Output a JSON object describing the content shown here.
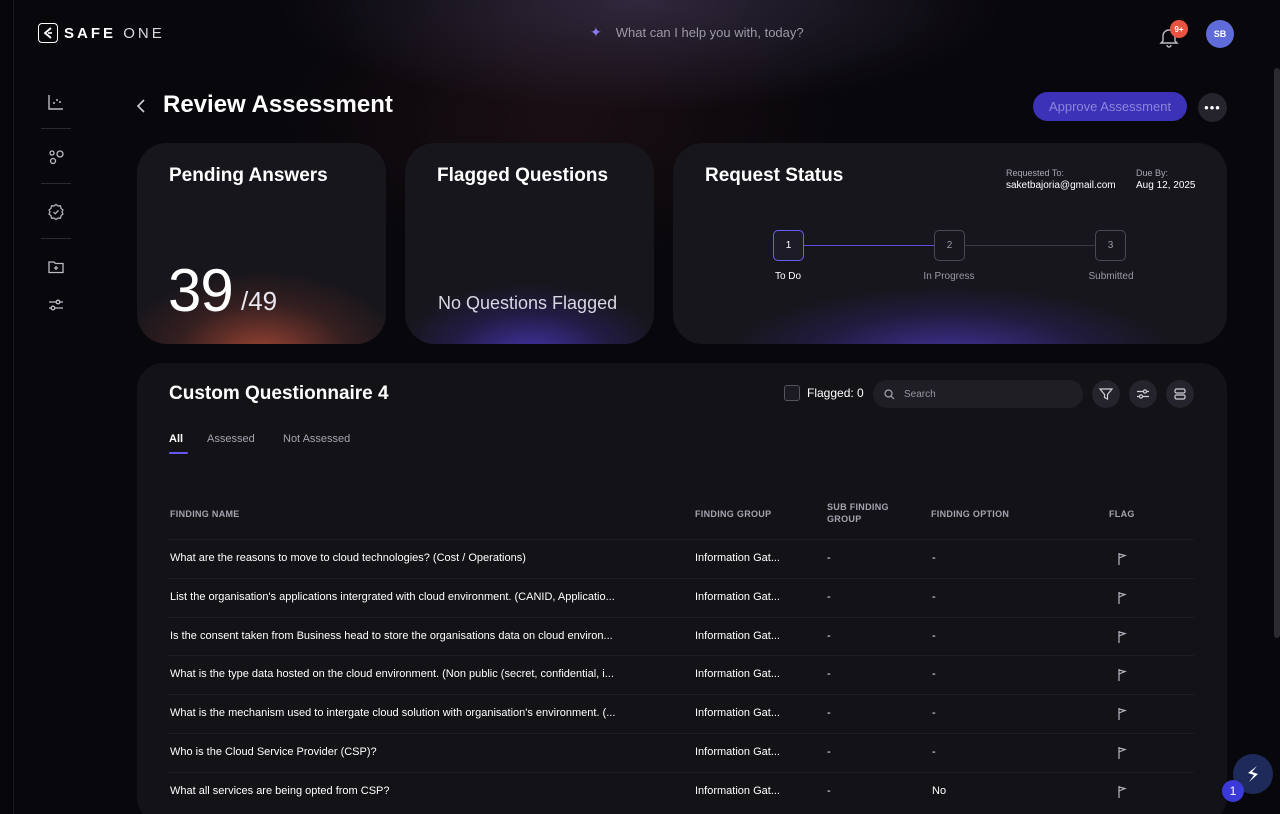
{
  "brand": {
    "bold": "SAFE",
    "light": "ONE"
  },
  "assistant": {
    "prompt": "What can I help you with, today?"
  },
  "notifications": {
    "count": "9+"
  },
  "user": {
    "initials": "SB"
  },
  "sidebar": {
    "items": [
      {
        "icon": "chart-icon"
      },
      {
        "icon": "nodes-icon"
      },
      {
        "icon": "gear-badge-icon"
      },
      {
        "icon": "folder-add-icon"
      },
      {
        "icon": "sliders-icon"
      }
    ]
  },
  "header": {
    "title": "Review Assessment",
    "approve_label": "Approve Assessment",
    "more_label": "•••"
  },
  "pending": {
    "title": "Pending Answers",
    "answered": "39",
    "total": "/49"
  },
  "flagged": {
    "title": "Flagged Questions",
    "empty_text": "No Questions Flagged"
  },
  "status": {
    "title": "Request Status",
    "requested_to_label": "Requested To:",
    "requested_to": "saketbajoria@gmail.com",
    "due_label": "Due By:",
    "due": "Aug 12, 2025",
    "steps": [
      {
        "num": "1",
        "label": "To Do",
        "active": true
      },
      {
        "num": "2",
        "label": "In Progress",
        "active": false
      },
      {
        "num": "3",
        "label": "Submitted",
        "active": false
      }
    ]
  },
  "questionnaire": {
    "title": "Custom Questionnaire 4",
    "flagged_filter": "Flagged: 0",
    "search_placeholder": "Search",
    "tabs": [
      {
        "label": "All",
        "active": true
      },
      {
        "label": "Assessed",
        "active": false
      },
      {
        "label": "Not Assessed",
        "active": false
      }
    ],
    "columns": {
      "finding_name": "FINDING NAME",
      "finding_group": "FINDING GROUP",
      "sub_group_1": "SUB FINDING",
      "sub_group_2": "GROUP",
      "finding_option": "FINDING OPTION",
      "flag": "FLAG"
    },
    "rows": [
      {
        "name": "What are the reasons to move to cloud technologies? (Cost / Operations)",
        "group": "Information Gat...",
        "sub": "-",
        "option": "-"
      },
      {
        "name": "List the organisation's applications intergrated with cloud environment. (CANID, Applicatio...",
        "group": "Information Gat...",
        "sub": "-",
        "option": "-"
      },
      {
        "name": "Is the consent taken from Business head to store the organisations data on cloud environ...",
        "group": "Information Gat...",
        "sub": "-",
        "option": "-"
      },
      {
        "name": "What is the type data hosted on the cloud environment. (Non public (secret, confidential, i...",
        "group": "Information Gat...",
        "sub": "-",
        "option": "-"
      },
      {
        "name": "What is the mechanism used to intergate cloud solution with organisation's environment. (...",
        "group": "Information Gat...",
        "sub": "-",
        "option": "-"
      },
      {
        "name": "Who is the Cloud Service Provider (CSP)?",
        "group": "Information Gat...",
        "sub": "-",
        "option": "-"
      },
      {
        "name": "What all services are being opted from CSP?",
        "group": "Information Gat...",
        "sub": "-",
        "option": "No"
      }
    ]
  },
  "helper": {
    "count": "1"
  },
  "colors": {
    "accent": "#6657f0",
    "approve_bg": "#3b32b8",
    "badge": "#e8543f",
    "avatar": "#5f6bd9"
  }
}
